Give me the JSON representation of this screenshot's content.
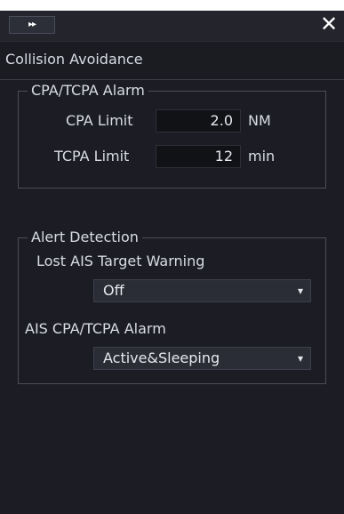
{
  "header": {
    "expand_label": "▸▸",
    "close_label": "✕"
  },
  "panel": {
    "title": "Collision Avoidance"
  },
  "cpa_group": {
    "legend": "CPA/TCPA Alarm",
    "cpa_limit_label": "CPA Limit",
    "cpa_limit_value": "2.0",
    "cpa_limit_unit": "NM",
    "tcpa_limit_label": "TCPA Limit",
    "tcpa_limit_value": "12",
    "tcpa_limit_unit": "min"
  },
  "alert_group": {
    "legend": "Alert Detection",
    "lost_ais_label": "Lost AIS Target Warning",
    "lost_ais_value": "Off",
    "ais_cpa_label": "AIS CPA/TCPA Alarm",
    "ais_cpa_value": "Active&Sleeping",
    "dropdown_arrow": "▾"
  },
  "colors": {
    "panel_bg": "#1c1d24",
    "text": "#d8dce4",
    "field_bg": "#111216",
    "dropdown_bg": "#2b2d36"
  }
}
